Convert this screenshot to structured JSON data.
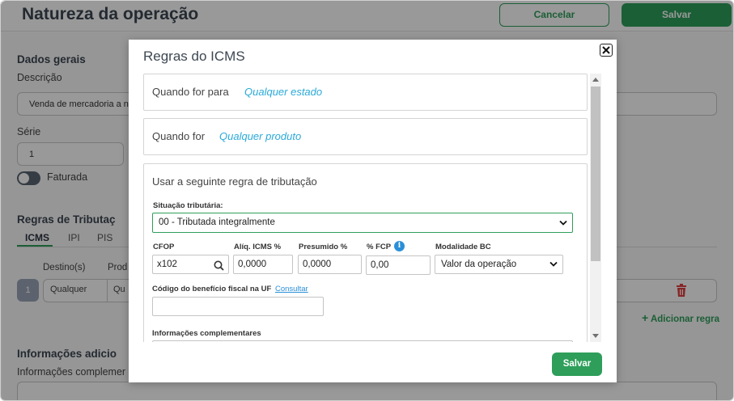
{
  "header": {
    "title": "Natureza da operação",
    "cancel_label": "Cancelar",
    "save_label": "Salvar"
  },
  "background": {
    "general_section": "Dados gerais",
    "description_label": "Descrição",
    "description_value": "Venda de mercadoria a n",
    "series_label": "Série",
    "series_value": "1",
    "invoiced_label": "Faturada",
    "tax_rules_section": "Regras de Tributaç",
    "tabs": [
      "ICMS",
      "IPI",
      "PIS"
    ],
    "col_destinations": "Destino(s)",
    "col_products": "Prod",
    "row_number": "1",
    "row_destination": "Qualquer",
    "row_product": "Qu",
    "add_rule_label": "Adicionar regra",
    "extra_info_section": "Informações adicio",
    "extra_info_label": "Informações complemer"
  },
  "modal": {
    "title": "Regras do ICMS",
    "when_for_label": "Quando for para",
    "when_for_value": "Qualquer estado",
    "when_product_label": "Quando for",
    "when_product_value": "Qualquer produto",
    "rule_heading": "Usar a seguinte regra de tributação",
    "tax_situation_label": "Situação tributária:",
    "tax_situation_value": "00 - Tributada integralmente",
    "cfop_label": "CFOP",
    "cfop_value": "x102",
    "icms_rate_label": "Alíq. ICMS %",
    "icms_rate_value": "0,0000",
    "presumed_label": "Presumido %",
    "presumed_value": "0,0000",
    "fcp_label": "% FCP",
    "fcp_value": "0,00",
    "bc_mode_label": "Modalidade BC",
    "bc_mode_value": "Valor da operação",
    "benefit_code_label": "Código do benefício fiscal na UF",
    "benefit_code_link": "Consultar",
    "benefit_code_value": "",
    "complementary_info_label": "Informações complementares",
    "save_label": "Salvar"
  },
  "colors": {
    "accent_green": "#2e9e5a",
    "link_blue": "#2aa9d8"
  }
}
